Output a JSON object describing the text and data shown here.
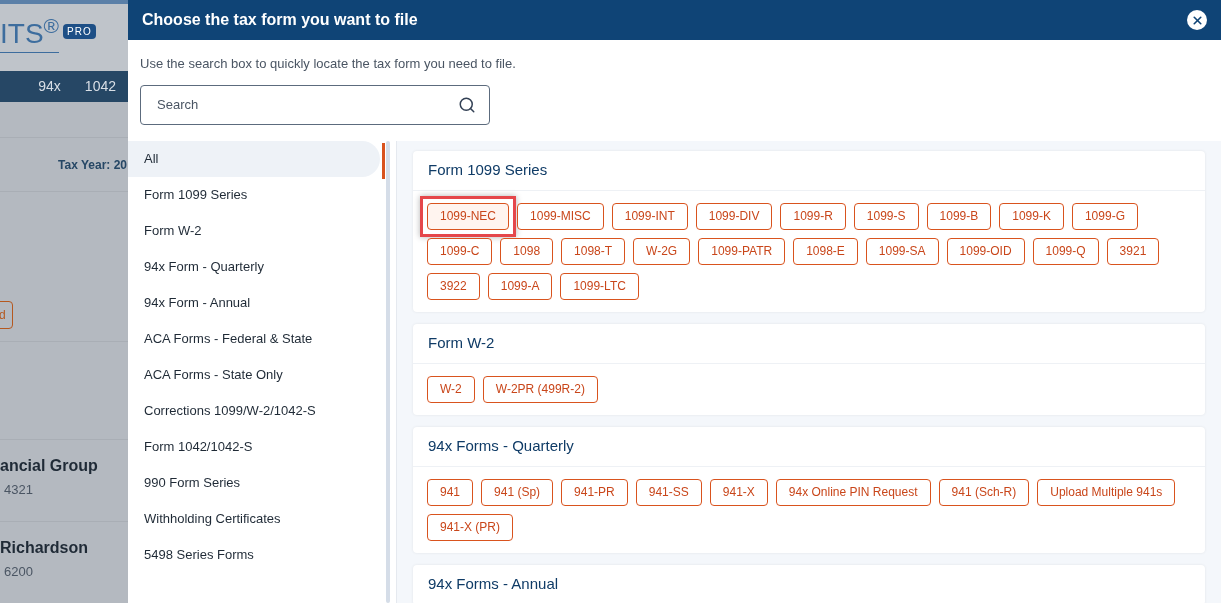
{
  "background": {
    "logo": "ITS$^{®}$",
    "badge": "PRO",
    "nav": [
      "94x",
      "1042"
    ],
    "tax_year": "Tax Year: 20",
    "button": "d",
    "rows": [
      {
        "name": "ancial Group",
        "id": "4321"
      },
      {
        "name": "Richardson",
        "id": "6200"
      }
    ]
  },
  "dialog": {
    "title": "Choose the tax form you want to file",
    "hint": "Use the search box to quickly locate the tax form you need to file.",
    "search": {
      "placeholder": "Search"
    },
    "categories": [
      {
        "label": "All",
        "selected": true
      },
      {
        "label": "Form 1099 Series",
        "selected": false
      },
      {
        "label": "Form W-2",
        "selected": false
      },
      {
        "label": "94x Form - Quarterly",
        "selected": false
      },
      {
        "label": "94x Form - Annual",
        "selected": false
      },
      {
        "label": "ACA Forms - Federal & State",
        "selected": false
      },
      {
        "label": "ACA Forms - State Only",
        "selected": false
      },
      {
        "label": "Corrections 1099/W-2/1042-S",
        "selected": false
      },
      {
        "label": "Form 1042/1042-S",
        "selected": false
      },
      {
        "label": "990 Form Series",
        "selected": false
      },
      {
        "label": "Withholding Certificates",
        "selected": false
      },
      {
        "label": "5498 Series Forms",
        "selected": false
      }
    ],
    "sections": [
      {
        "title": "Form 1099 Series",
        "forms": [
          {
            "label": "1099-NEC",
            "highlighted": true
          },
          {
            "label": "1099-MISC",
            "highlighted": false
          },
          {
            "label": "1099-INT",
            "highlighted": false
          },
          {
            "label": "1099-DIV",
            "highlighted": false
          },
          {
            "label": "1099-R",
            "highlighted": false
          },
          {
            "label": "1099-S",
            "highlighted": false
          },
          {
            "label": "1099-B",
            "highlighted": false
          },
          {
            "label": "1099-K",
            "highlighted": false
          },
          {
            "label": "1099-G",
            "highlighted": false
          },
          {
            "label": "1099-C",
            "highlighted": false
          },
          {
            "label": "1098",
            "highlighted": false
          },
          {
            "label": "1098-T",
            "highlighted": false
          },
          {
            "label": "W-2G",
            "highlighted": false
          },
          {
            "label": "1099-PATR",
            "highlighted": false
          },
          {
            "label": "1098-E",
            "highlighted": false
          },
          {
            "label": "1099-SA",
            "highlighted": false
          },
          {
            "label": "1099-OID",
            "highlighted": false
          },
          {
            "label": "1099-Q",
            "highlighted": false
          },
          {
            "label": "3921",
            "highlighted": false
          },
          {
            "label": "3922",
            "highlighted": false
          },
          {
            "label": "1099-A",
            "highlighted": false
          },
          {
            "label": "1099-LTC",
            "highlighted": false
          }
        ]
      },
      {
        "title": "Form W-2",
        "forms": [
          {
            "label": "W-2",
            "highlighted": false
          },
          {
            "label": "W-2PR (499R-2)",
            "highlighted": false
          }
        ]
      },
      {
        "title": "94x Forms - Quarterly",
        "forms": [
          {
            "label": "941",
            "highlighted": false
          },
          {
            "label": "941 (Sp)",
            "highlighted": false
          },
          {
            "label": "941-PR",
            "highlighted": false
          },
          {
            "label": "941-SS",
            "highlighted": false
          },
          {
            "label": "941-X",
            "highlighted": false
          },
          {
            "label": "94x Online PIN Request",
            "highlighted": false
          },
          {
            "label": "941 (Sch-R)",
            "highlighted": false
          },
          {
            "label": "Upload Multiple 941s",
            "highlighted": false
          },
          {
            "label": "941-X (PR)",
            "highlighted": false
          }
        ]
      },
      {
        "title": "94x Forms - Annual"
      }
    ]
  }
}
